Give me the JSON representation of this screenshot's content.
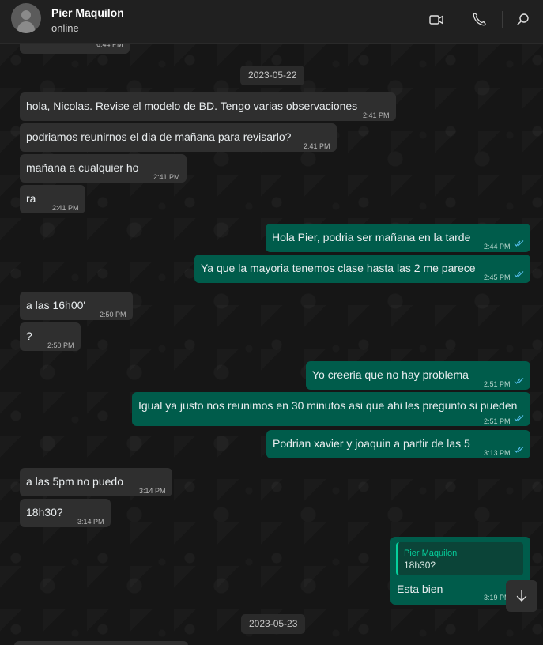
{
  "header": {
    "contact_name": "Pier Maquilon",
    "status": "online",
    "icons": [
      "video-call-icon",
      "voice-call-icon",
      "search-icon"
    ]
  },
  "colors": {
    "incoming_bubble": "#2f2f2f",
    "outgoing_bubble": "#005c4b",
    "read_ticks": "#53bdeb",
    "quote_accent": "#06cf9c"
  },
  "chat": {
    "top_partial_time": "6:44 PM",
    "date_1": "2023-05-22",
    "date_2": "2023-05-23",
    "messages": [
      {
        "dir": "in",
        "text": "hola, Nicolas. Revise el modelo de BD. Tengo varias observaciones",
        "time": "2:41 PM"
      },
      {
        "dir": "in",
        "text": "podriamos reunirnos el dia de mañana para revisarlo?",
        "time": "2:41 PM"
      },
      {
        "dir": "in",
        "text": "mañana a cualquier ho",
        "time": "2:41 PM"
      },
      {
        "dir": "in",
        "text": "ra",
        "time": "2:41 PM"
      },
      {
        "dir": "out",
        "text": "Hola Pier, podria ser mañana en la tarde",
        "time": "2:44 PM"
      },
      {
        "dir": "out",
        "text": "Ya que la mayoria tenemos clase hasta las 2 me parece",
        "time": "2:45 PM"
      },
      {
        "dir": "in",
        "text": "a las 16h00'",
        "time": "2:50 PM"
      },
      {
        "dir": "in",
        "text": "?",
        "time": "2:50 PM"
      },
      {
        "dir": "out",
        "text": "Yo creeria que no hay problema",
        "time": "2:51 PM"
      },
      {
        "dir": "out",
        "text": "Igual ya justo nos reunimos en 30 minutos asi que ahi les pregunto si pueden",
        "time": "2:51 PM"
      },
      {
        "dir": "out",
        "text": "Podrian xavier y joaquin a partir de las 5",
        "time": "3:13 PM"
      },
      {
        "dir": "in",
        "text": "a las 5pm no puedo",
        "time": "3:14 PM"
      },
      {
        "dir": "in",
        "text": "18h30?",
        "time": "3:14 PM"
      },
      {
        "dir": "out",
        "text": "Esta bien",
        "time": "3:19 PM",
        "quote_author": "Pier Maquilon",
        "quote_text": "18h30?"
      }
    ]
  }
}
